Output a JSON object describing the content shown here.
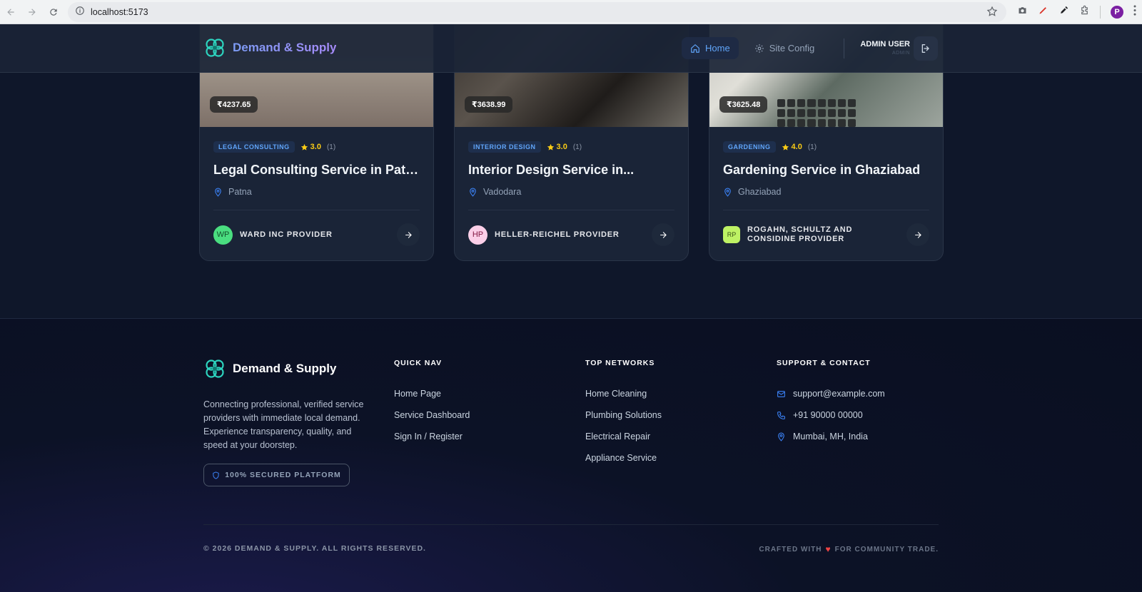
{
  "browser": {
    "url": "localhost:5173",
    "profile_initial": "P"
  },
  "header": {
    "brand": "Demand & Supply",
    "nav": [
      {
        "label": "Home",
        "active": true
      },
      {
        "label": "Site Config",
        "active": false
      }
    ],
    "user_name": "ADMIN USER",
    "user_role": "ADMIN"
  },
  "cards": [
    {
      "price": "₹4237.65",
      "category": "LEGAL CONSULTING",
      "rating": "3.0",
      "count": "(1)",
      "title": "Legal Consulting Service in Patna",
      "location": "Patna",
      "provider_initials": "WP",
      "provider_name": "WARD INC PROVIDER",
      "avatar_color": "#4ade80"
    },
    {
      "price": "₹3638.99",
      "category": "INTERIOR DESIGN",
      "rating": "3.0",
      "count": "(1)",
      "title": "Interior Design Service in...",
      "location": "Vadodara",
      "provider_initials": "HP",
      "provider_name": "HELLER-REICHEL PROVIDER",
      "avatar_color": "#fbcfe8"
    },
    {
      "price": "₹3625.48",
      "category": "GARDENING",
      "rating": "4.0",
      "count": "(1)",
      "title": "Gardening Service in Ghaziabad",
      "location": "Ghaziabad",
      "provider_initials": "RP",
      "provider_name": "ROGAHN, SCHULTZ AND CONSIDINE PROVIDER",
      "avatar_color": "#bef264"
    }
  ],
  "footer": {
    "brand": "Demand & Supply",
    "description": "Connecting professional, verified service providers with immediate local demand. Experience transparency, quality, and speed at your doorstep.",
    "secure_badge": "100% SECURED PLATFORM",
    "quick_nav": {
      "title": "QUICK NAV",
      "items": [
        "Home Page",
        "Service Dashboard",
        "Sign In / Register"
      ]
    },
    "top_networks": {
      "title": "TOP NETWORKS",
      "items": [
        "Home Cleaning",
        "Plumbing Solutions",
        "Electrical Repair",
        "Appliance Service"
      ]
    },
    "support": {
      "title": "SUPPORT & CONTACT",
      "email": "support@example.com",
      "phone": "+91 90000 00000",
      "address": "Mumbai, MH, India"
    },
    "copyright": "© 2026 DEMAND & SUPPLY. ALL RIGHTS RESERVED.",
    "crafted_before": "CRAFTED WITH",
    "crafted_after": "FOR COMMUNITY TRADE."
  },
  "colors": {
    "accent": "#3b82f6",
    "star": "#facc15",
    "heart": "#ef4444",
    "brand_gradient": [
      "#7c9cf5",
      "#a78bfa"
    ]
  }
}
